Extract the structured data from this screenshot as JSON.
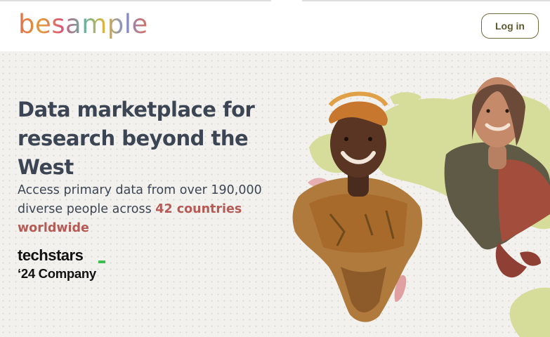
{
  "header": {
    "logo_text": "besample",
    "login_label": "Log in"
  },
  "hero": {
    "headline": [
      "Data marketplace for",
      "research beyond the",
      "West"
    ],
    "subtitle_part1": "Access primary data from over 190,000 diverse people across ",
    "subtitle_highlight": "42 countries worldwide",
    "badge_line1": "techstars",
    "badge_line2": "‘24 Company"
  },
  "colors": {
    "accent": "#b55a55",
    "heading": "#3b4554",
    "button_border": "#6f6c3c",
    "map_green": "#d6dd9a",
    "techstars_green": "#3fbf4f"
  }
}
